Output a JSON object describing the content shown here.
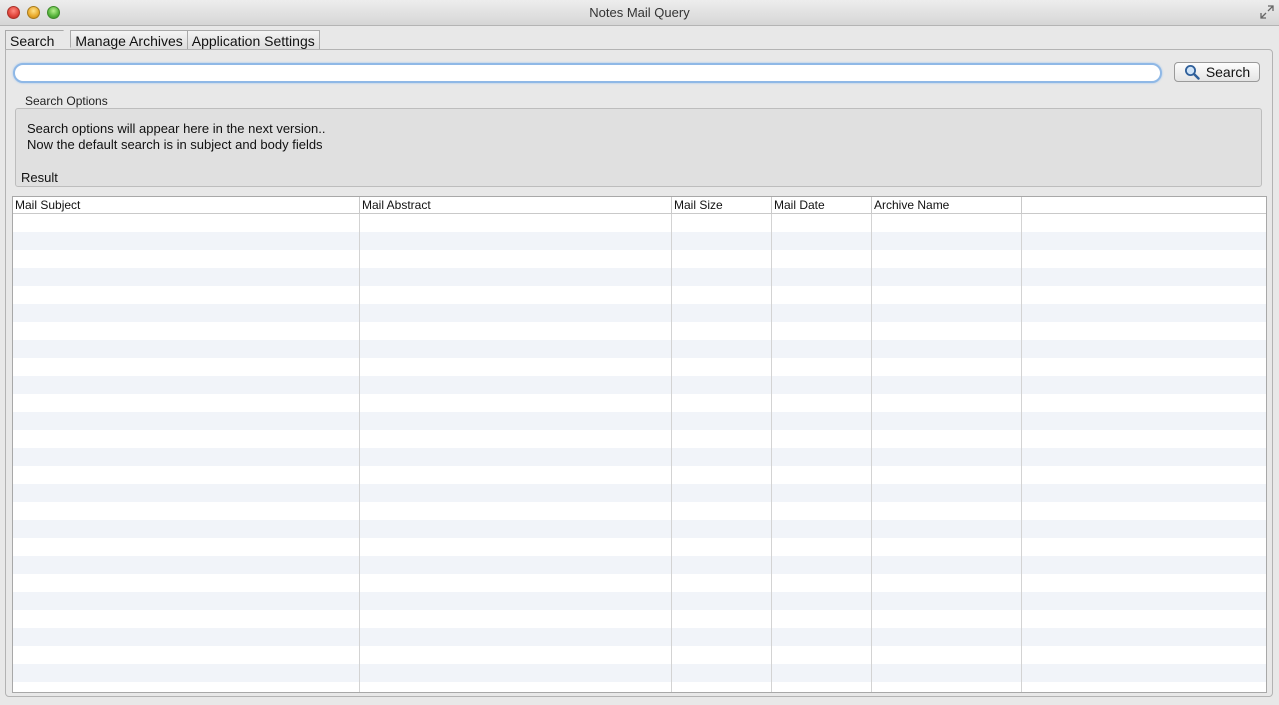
{
  "window": {
    "title": "Notes Mail Query"
  },
  "tabs": [
    {
      "label": "Search",
      "active": true
    },
    {
      "label": "Manage Archives",
      "active": false
    },
    {
      "label": "Application Settings",
      "active": false
    }
  ],
  "search": {
    "value": "",
    "placeholder": "",
    "button_label": "Search"
  },
  "options": {
    "label": "Search Options",
    "line1": "Search options will appear here in the next version..",
    "line2": "Now the default search is in subject and body fields"
  },
  "result": {
    "label": "Result",
    "columns": [
      "Mail Subject",
      "Mail Abstract",
      "Mail Size",
      "Mail Date",
      "Archive Name",
      ""
    ],
    "rows": []
  },
  "colors": {
    "focus_ring": "#8fb8e6",
    "row_stripe": "#f1f4f9"
  },
  "icons": {
    "close": "close-button-icon",
    "minimize": "minimize-button-icon",
    "zoom": "zoom-button-icon",
    "fullscreen": "fullscreen-icon",
    "search": "magnifier-icon"
  }
}
